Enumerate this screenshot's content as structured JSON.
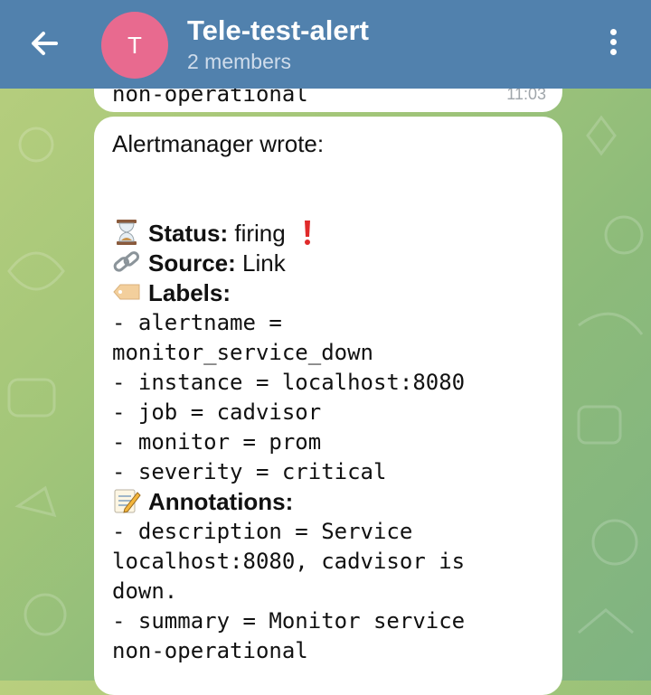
{
  "header": {
    "avatar_letter": "T",
    "chat_title": "Tele-test-alert",
    "subtitle": "2 members"
  },
  "previous_message": {
    "text": "non-operational",
    "time": "11:03"
  },
  "message": {
    "intro": "Alertmanager wrote:",
    "status_label": "Status:",
    "status_value": " firing",
    "source_label": "Source:",
    "source_value": " Link",
    "labels_heading": "Labels:",
    "labels": [
      "- alertname =",
      "monitor_service_down",
      "- instance = localhost:8080",
      "- job = cadvisor",
      "- monitor = prom",
      "- severity = critical"
    ],
    "annotations_heading": "Annotations:",
    "annotations": [
      "- description = Service",
      "localhost:8080, cadvisor is",
      "down.",
      "- summary = Monitor service",
      "non-operational"
    ]
  },
  "icons": {
    "status": "hourglass-icon",
    "exclamation": "red-exclamation-icon",
    "source": "link-icon",
    "labels": "label-tag-icon",
    "annotations": "memo-icon"
  },
  "colors": {
    "header_bg": "#5181ad",
    "avatar_bg": "#e86a8f",
    "bubble_bg": "#ffffff"
  }
}
